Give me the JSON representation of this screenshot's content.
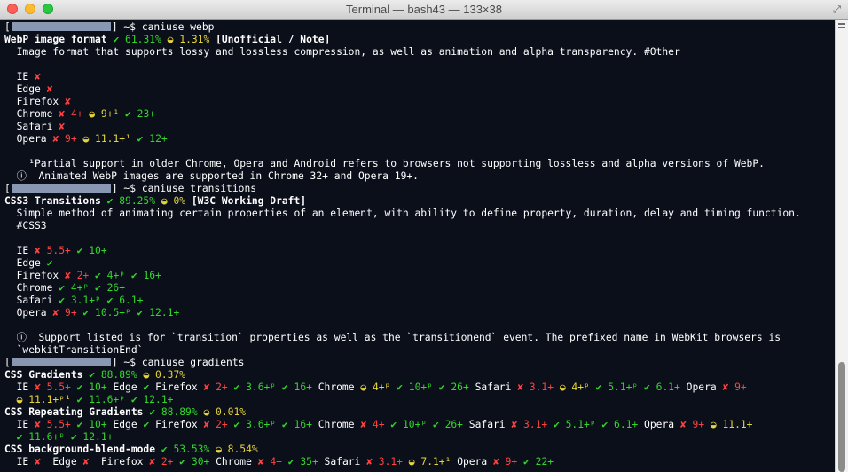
{
  "window": {
    "title": "Terminal — bash43 — 133×38",
    "icons": [
      "close-button",
      "minimize-button",
      "zoom-button",
      "fullscreen-icon"
    ]
  },
  "colors": {
    "background": "#0b0f1a",
    "text": "#ffffff",
    "supported": "#33d62b",
    "unsupported": "#ff4141",
    "partial": "#e6d43a"
  },
  "terminal": {
    "lines": [
      [
        [
          "w",
          "["
        ],
        [
          "mask",
          ""
        ],
        [
          "w",
          "] ~$ caniuse webp"
        ]
      ],
      [
        [
          "b",
          "WebP image format "
        ],
        [
          "g",
          "✔ 61.31%"
        ],
        [
          "y",
          " ◒ 1.31%"
        ],
        [
          "b",
          " [Unofficial / Note]"
        ]
      ],
      [
        [
          "w",
          "  Image format that supports lossy and lossless compression, as well as animation and alpha transparency. #Other"
        ]
      ],
      [],
      [
        [
          "w",
          "  IE "
        ],
        [
          "r",
          "✘"
        ]
      ],
      [
        [
          "w",
          "  Edge "
        ],
        [
          "r",
          "✘"
        ]
      ],
      [
        [
          "w",
          "  Firefox "
        ],
        [
          "r",
          "✘"
        ]
      ],
      [
        [
          "w",
          "  Chrome "
        ],
        [
          "r",
          "✘ 4+"
        ],
        [
          "y",
          " ◒ 9+¹"
        ],
        [
          "g",
          " ✔ 23+"
        ]
      ],
      [
        [
          "w",
          "  Safari "
        ],
        [
          "r",
          "✘"
        ]
      ],
      [
        [
          "w",
          "  Opera "
        ],
        [
          "r",
          "✘ 9+"
        ],
        [
          "y",
          " ◒ 11.1+¹"
        ],
        [
          "g",
          " ✔ 12+"
        ]
      ],
      [],
      [
        [
          "w",
          "    ¹Partial support in older Chrome, Opera and Android refers to browsers not supporting lossless and alpha versions of WebP."
        ]
      ],
      [
        [
          "w",
          "  ⓘ  Animated WebP images are supported in Chrome 32+ and Opera 19+."
        ]
      ],
      [
        [
          "w",
          "["
        ],
        [
          "mask",
          ""
        ],
        [
          "w",
          "] ~$ caniuse transitions"
        ]
      ],
      [
        [
          "b",
          "CSS3 Transitions "
        ],
        [
          "g",
          "✔ 89.25%"
        ],
        [
          "y",
          " ◒ 0%"
        ],
        [
          "b",
          " [W3C Working Draft]"
        ]
      ],
      [
        [
          "w",
          "  Simple method of animating certain properties of an element, with ability to define property, duration, delay and timing function."
        ]
      ],
      [
        [
          "w",
          "  #CSS3"
        ]
      ],
      [],
      [
        [
          "w",
          "  IE "
        ],
        [
          "r",
          "✘ 5.5+"
        ],
        [
          "g",
          " ✔ 10+"
        ]
      ],
      [
        [
          "w",
          "  Edge "
        ],
        [
          "g",
          "✔"
        ]
      ],
      [
        [
          "w",
          "  Firefox "
        ],
        [
          "r",
          "✘ 2+"
        ],
        [
          "g",
          " ✔ 4+ᵖ ✔ 16+"
        ]
      ],
      [
        [
          "w",
          "  Chrome "
        ],
        [
          "g",
          "✔ 4+ᵖ ✔ 26+"
        ]
      ],
      [
        [
          "w",
          "  Safari "
        ],
        [
          "g",
          "✔ 3.1+ᵖ ✔ 6.1+"
        ]
      ],
      [
        [
          "w",
          "  Opera "
        ],
        [
          "r",
          "✘ 9+"
        ],
        [
          "g",
          " ✔ 10.5+ᵖ ✔ 12.1+"
        ]
      ],
      [],
      [
        [
          "w",
          "  ⓘ  Support listed is for `transition` properties as well as the `transitionend` event. The prefixed name in WebKit browsers is"
        ]
      ],
      [
        [
          "w",
          "  `webkitTransitionEnd`"
        ]
      ],
      [
        [
          "w",
          "["
        ],
        [
          "mask",
          ""
        ],
        [
          "w",
          "] ~$ caniuse gradients"
        ]
      ],
      [
        [
          "b",
          "CSS Gradients "
        ],
        [
          "g",
          "✔ 88.89%"
        ],
        [
          "y",
          " ◒ 0.37%"
        ]
      ],
      [
        [
          "w",
          "  IE "
        ],
        [
          "r",
          "✘ 5.5+"
        ],
        [
          "g",
          " ✔ 10+"
        ],
        [
          "w",
          " Edge "
        ],
        [
          "g",
          "✔"
        ],
        [
          "w",
          " Firefox "
        ],
        [
          "r",
          "✘ 2+"
        ],
        [
          "g",
          " ✔ 3.6+ᵖ ✔ 16+"
        ],
        [
          "w",
          " Chrome "
        ],
        [
          "y",
          "◒ 4+ᵖ"
        ],
        [
          "g",
          " ✔ 10+ᵖ ✔ 26+"
        ],
        [
          "w",
          " Safari "
        ],
        [
          "r",
          "✘ 3.1+"
        ],
        [
          "y",
          " ◒ 4+ᵖ"
        ],
        [
          "g",
          " ✔ 5.1+ᵖ ✔ 6.1+"
        ],
        [
          "w",
          " Opera "
        ],
        [
          "r",
          "✘ 9+"
        ]
      ],
      [
        [
          "y",
          "  ◒ 11.1+ᵖ¹"
        ],
        [
          "g",
          " ✔ 11.6+ᵖ ✔ 12.1+"
        ]
      ],
      [
        [
          "b",
          "CSS Repeating Gradients "
        ],
        [
          "g",
          "✔ 88.89%"
        ],
        [
          "y",
          " ◒ 0.01%"
        ]
      ],
      [
        [
          "w",
          "  IE "
        ],
        [
          "r",
          "✘ 5.5+"
        ],
        [
          "g",
          " ✔ 10+"
        ],
        [
          "w",
          " Edge "
        ],
        [
          "g",
          "✔"
        ],
        [
          "w",
          " Firefox "
        ],
        [
          "r",
          "✘ 2+"
        ],
        [
          "g",
          " ✔ 3.6+ᵖ ✔ 16+"
        ],
        [
          "w",
          " Chrome "
        ],
        [
          "r",
          "✘ 4+"
        ],
        [
          "g",
          " ✔ 10+ᵖ ✔ 26+"
        ],
        [
          "w",
          " Safari "
        ],
        [
          "r",
          "✘ 3.1+"
        ],
        [
          "g",
          " ✔ 5.1+ᵖ ✔ 6.1+"
        ],
        [
          "w",
          " Opera "
        ],
        [
          "r",
          "✘ 9+"
        ],
        [
          "y",
          " ◒ 11.1+"
        ]
      ],
      [
        [
          "g",
          "  ✔ 11.6+ᵖ ✔ 12.1+"
        ]
      ],
      [
        [
          "b",
          "CSS background-blend-mode "
        ],
        [
          "g",
          "✔ 53.53%"
        ],
        [
          "y",
          " ◒ 8.54%"
        ]
      ],
      [
        [
          "w",
          "  IE "
        ],
        [
          "r",
          "✘"
        ],
        [
          "w",
          "  Edge "
        ],
        [
          "r",
          "✘"
        ],
        [
          "w",
          "  Firefox "
        ],
        [
          "r",
          "✘ 2+"
        ],
        [
          "g",
          " ✔ 30+"
        ],
        [
          "w",
          " Chrome "
        ],
        [
          "r",
          "✘ 4+"
        ],
        [
          "g",
          " ✔ 35+"
        ],
        [
          "w",
          " Safari "
        ],
        [
          "r",
          "✘ 3.1+"
        ],
        [
          "y",
          " ◒ 7.1+¹"
        ],
        [
          "w",
          " Opera "
        ],
        [
          "r",
          "✘ 9+"
        ],
        [
          "g",
          " ✔ 22+"
        ]
      ]
    ]
  }
}
